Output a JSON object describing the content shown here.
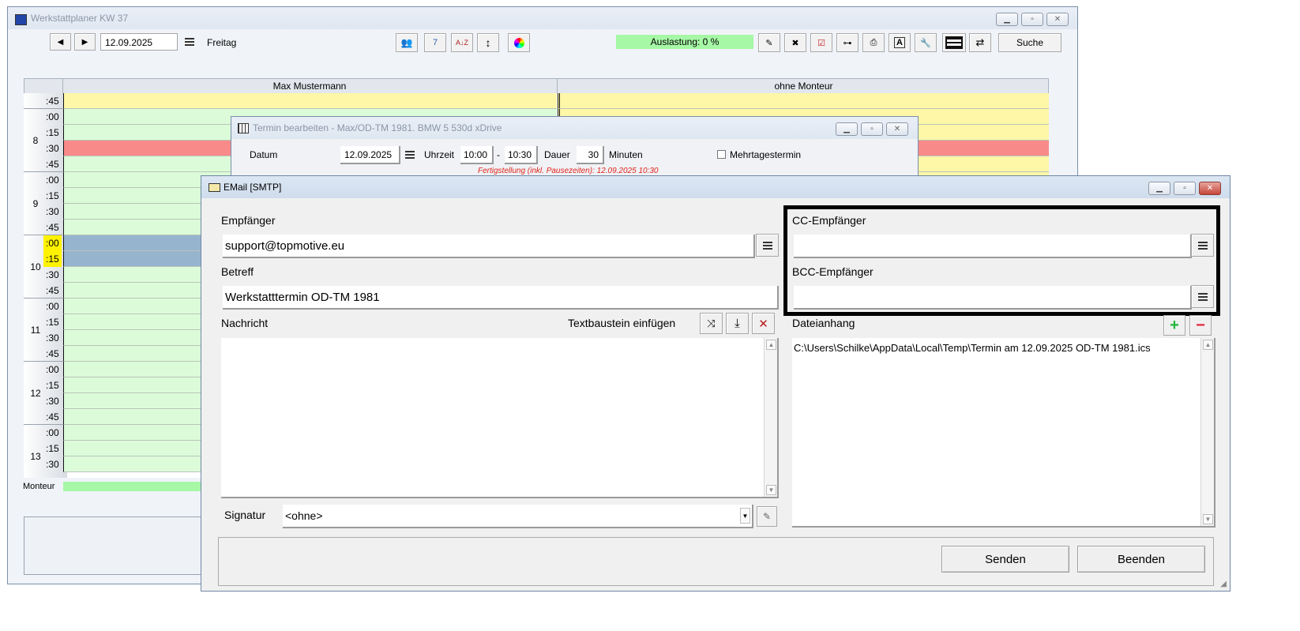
{
  "planner": {
    "title": "Werkstattplaner KW 37",
    "date": "12.09.2025",
    "weekday": "Freitag",
    "auslastung": "Auslastung: 0 %",
    "search_label": "Suche",
    "columns": [
      "Max Mustermann",
      "ohne Monteur"
    ],
    "time_rows": [
      ":45",
      ":00",
      ":15",
      ":30",
      ":45",
      ":00",
      ":15",
      ":30",
      ":45",
      ":00",
      ":15",
      ":30",
      ":45",
      ":00",
      ":15",
      ":30",
      ":45",
      ":00",
      ":15",
      ":30",
      ":45",
      ":00",
      ":15",
      ":30"
    ],
    "hours": [
      "8",
      "9",
      "10",
      "11",
      "12",
      "13"
    ],
    "footer_label": "Monteur",
    "colors": {
      "free": "#dcfcd9",
      "busy": "#fdf7a7",
      "alert": "#f98a8a",
      "selected": "#97b4cf",
      "highlight": "#fff200"
    }
  },
  "termin": {
    "title": "Termin bearbeiten - Max/OD-TM 1981. BMW 5 530d xDrive",
    "datum_label": "Datum",
    "datum": "12.09.2025",
    "uhrzeit_label": "Uhrzeit",
    "von": "10:00",
    "dash": "-",
    "bis": "10:30",
    "dauer_label": "Dauer",
    "dauer": "30",
    "minuten_label": "Minuten",
    "mehrtages_label": "Mehrtagestermin",
    "fertigstellung": "Fertigstellung (inkl. Pausezeiten): 12.09.2025 10:30"
  },
  "email": {
    "title": "EMail [SMTP]",
    "empfaenger_label": "Empfänger",
    "empfaenger": "support@topmotive.eu",
    "cc_label": "CC-Empfänger",
    "cc": "",
    "bcc_label": "BCC-Empfänger",
    "bcc": "",
    "betreff_label": "Betreff",
    "betreff": "Werkstatttermin OD-TM 1981",
    "nachricht_label": "Nachricht",
    "textbaustein_label": "Textbaustein einfügen",
    "nachricht": "",
    "dateianhang_label": "Dateianhang",
    "attachments": [
      "C:\\Users\\Schilke\\AppData\\Local\\Temp\\Termin am 12.09.2025 OD-TM 1981.ics"
    ],
    "signatur_label": "Signatur",
    "signatur": "<ohne>",
    "senden_label": "Senden",
    "beenden_label": "Beenden"
  }
}
